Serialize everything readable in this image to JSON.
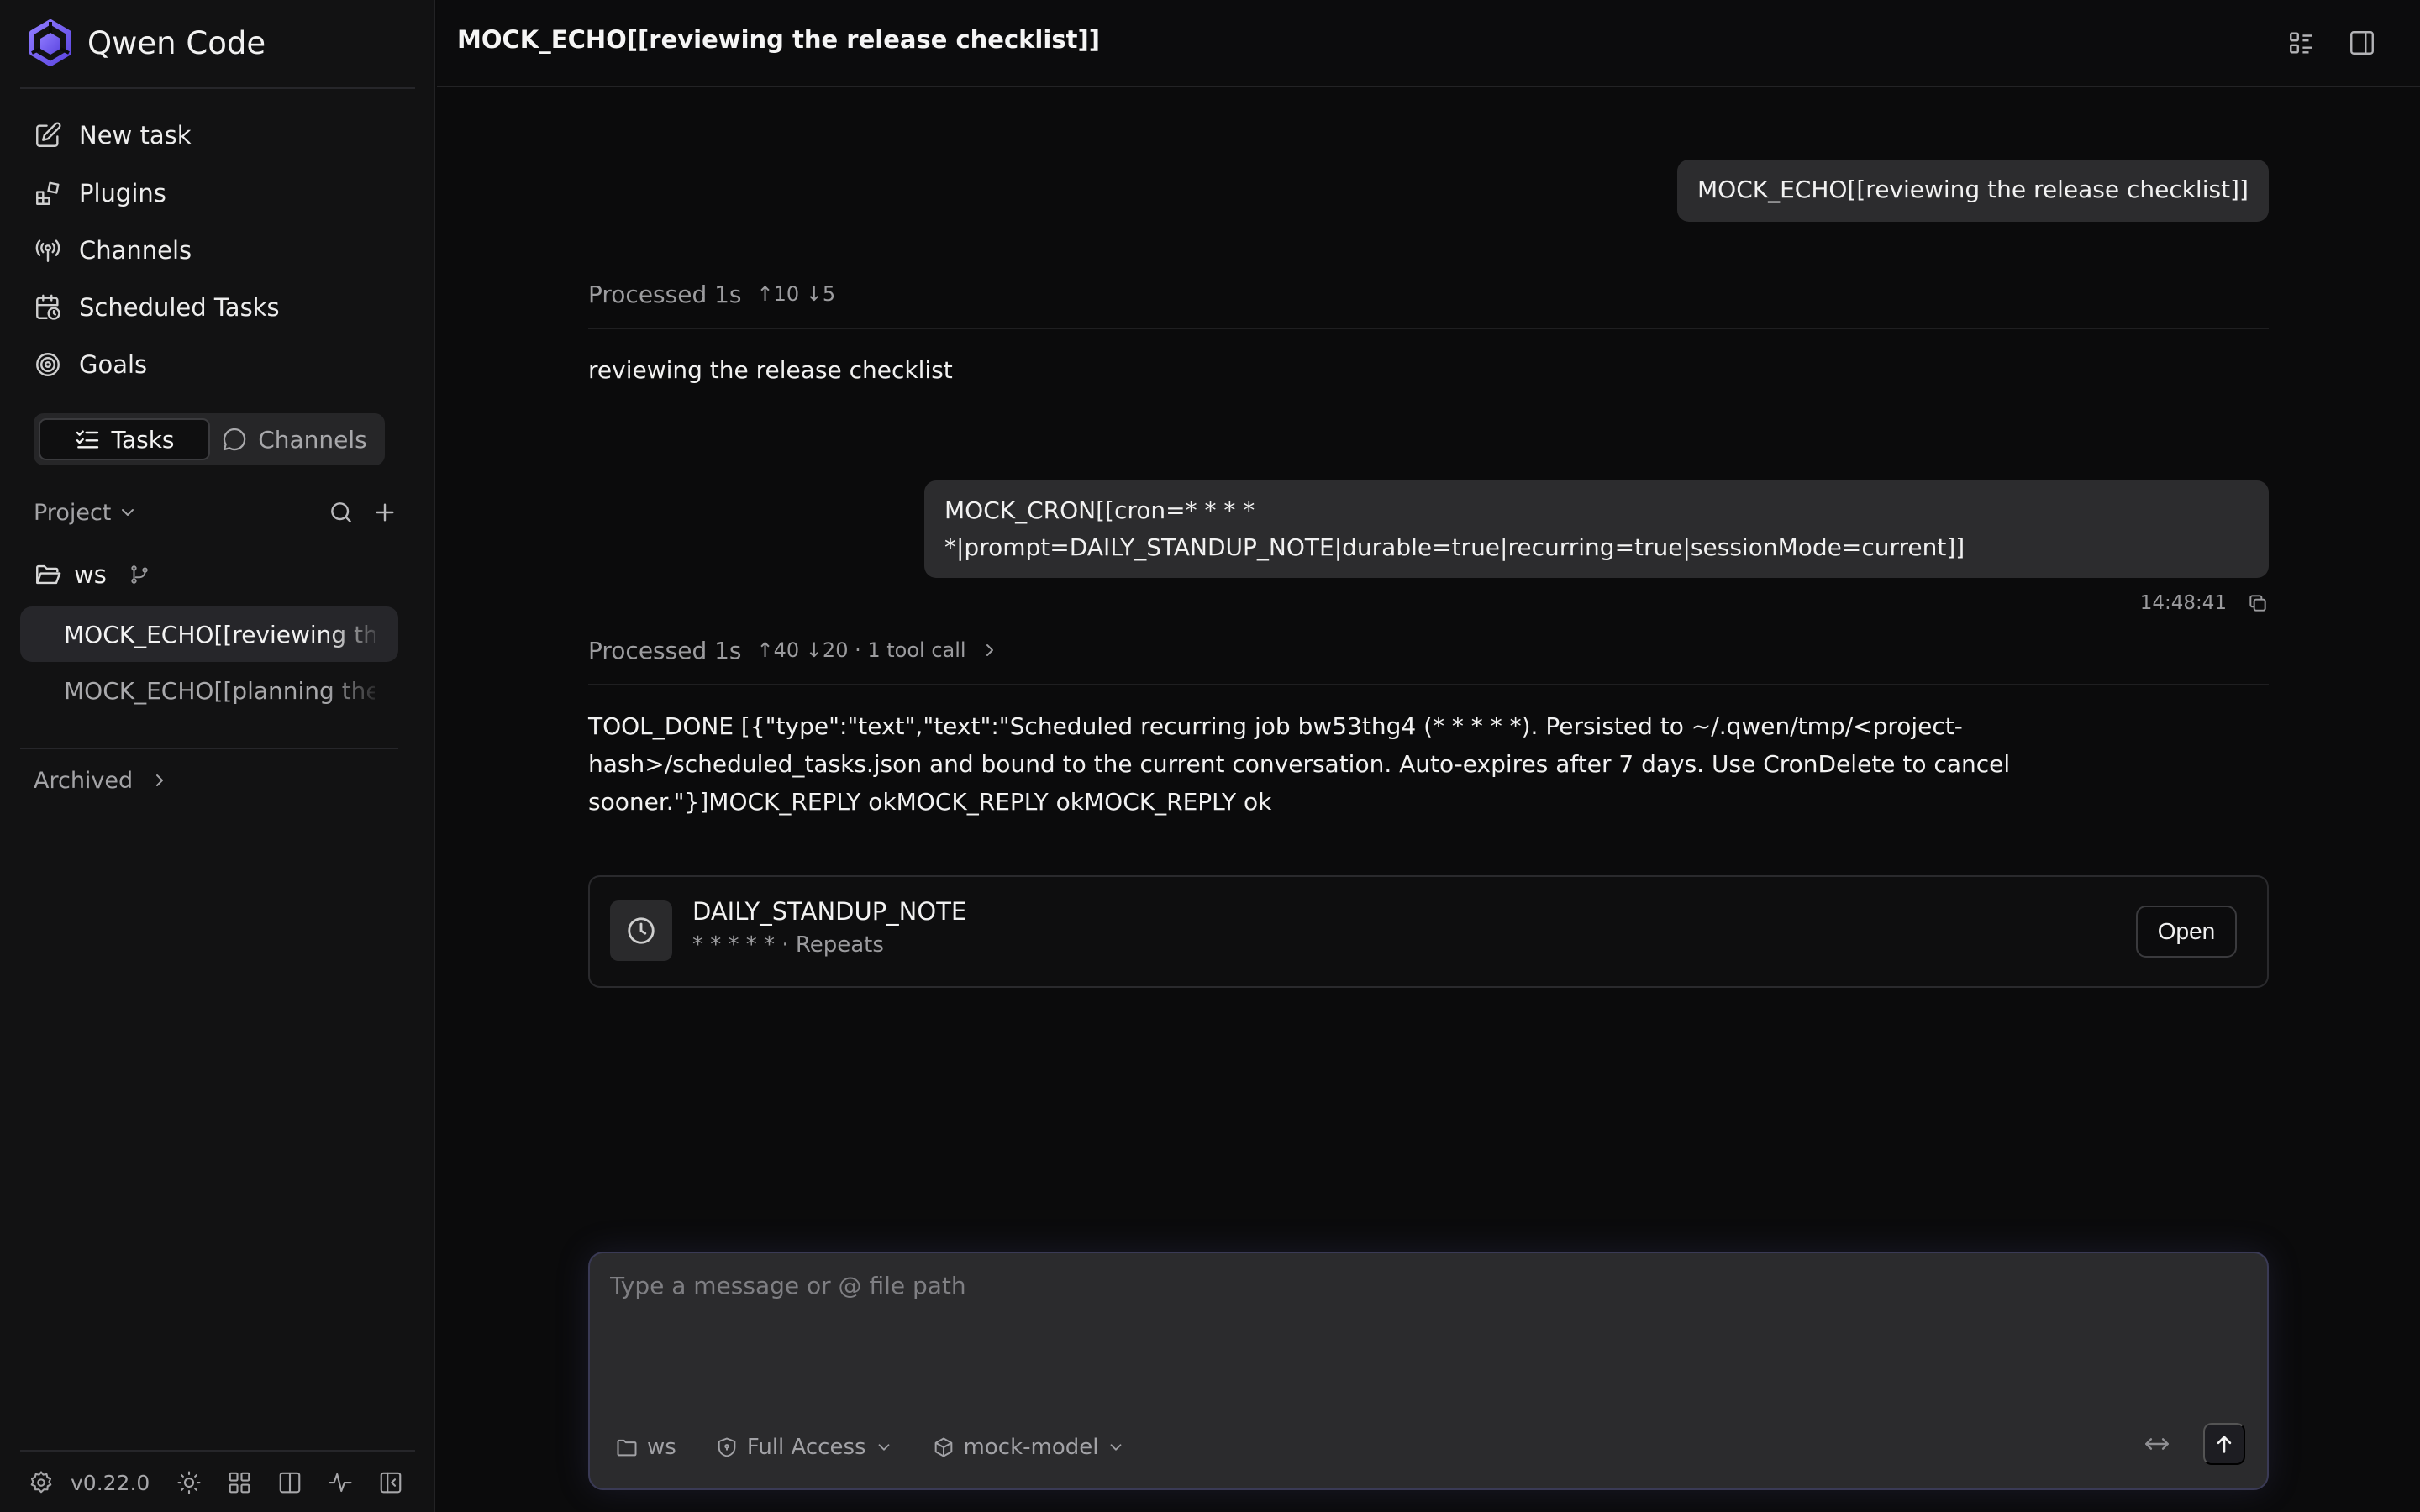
{
  "app": {
    "name": "Qwen Code",
    "version": "v0.22.0",
    "accent": "#6b5ce7"
  },
  "sidebar": {
    "nav": [
      {
        "label": "New task",
        "icon": "edit-icon"
      },
      {
        "label": "Plugins",
        "icon": "plugins-icon"
      },
      {
        "label": "Channels",
        "icon": "broadcast-icon"
      },
      {
        "label": "Scheduled Tasks",
        "icon": "calendar-clock-icon"
      },
      {
        "label": "Goals",
        "icon": "target-icon"
      }
    ],
    "segments": {
      "tasks": "Tasks",
      "channels": "Channels",
      "selected": "Tasks"
    },
    "project_label": "Project",
    "workspace": "ws",
    "sessions": [
      {
        "title": "MOCK_ECHO[[reviewing the release checklist]]",
        "active": true
      },
      {
        "title": "MOCK_ECHO[[planning the",
        "active": false
      }
    ],
    "archived_label": "Archived"
  },
  "header": {
    "title": "MOCK_ECHO[[reviewing the release checklist]]"
  },
  "conversation": {
    "user_message_1": "MOCK_ECHO[[reviewing the release checklist]]",
    "processed_1": {
      "label": "Processed 1s",
      "stats": "↑10 ↓5"
    },
    "reply_1": "reviewing the release checklist",
    "user_message_2": "MOCK_CRON[[cron=* * * * *|prompt=DAILY_STANDUP_NOTE|durable=true|recurring=true|sessionMode=current]]",
    "user_message_2_time": "14:48:41",
    "processed_2": {
      "label": "Processed 1s",
      "stats": "↑40 ↓20 · 1 tool call"
    },
    "reply_2": "TOOL_DONE [{\"type\":\"text\",\"text\":\"Scheduled recurring job bw53thg4 (* * * * *). Persisted to ~/.qwen/tmp/<project-hash>/scheduled_tasks.json and bound to the current conversation. Auto-expires after 7 days. Use CronDelete to cancel sooner.\"}]MOCK_REPLY okMOCK_REPLY okMOCK_REPLY ok",
    "scheduled_card": {
      "title": "DAILY_STANDUP_NOTE",
      "subtitle": "* * * * * · Repeats",
      "open_label": "Open"
    }
  },
  "composer": {
    "placeholder": "Type a message or @ file path",
    "value": "",
    "workspace": "ws",
    "access": "Full Access",
    "model": "mock-model"
  }
}
